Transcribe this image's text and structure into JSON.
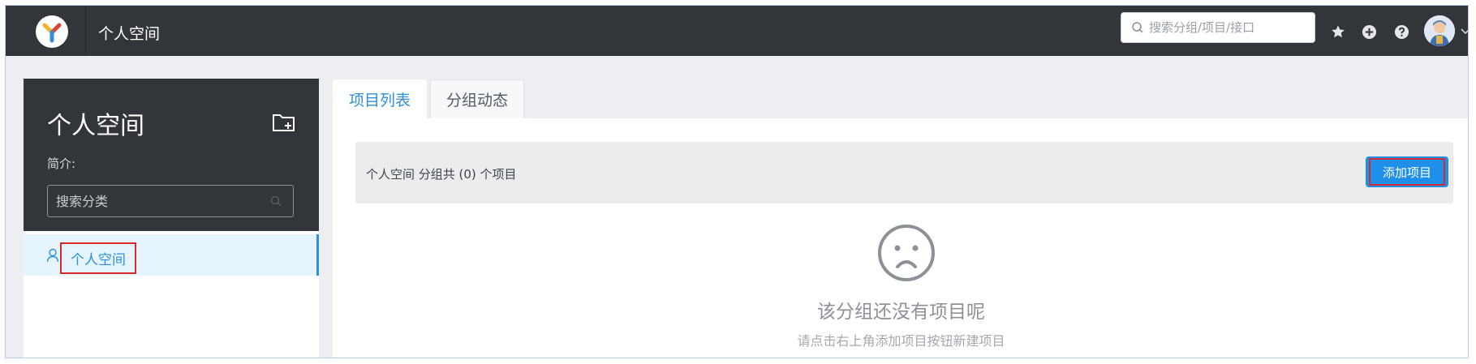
{
  "header": {
    "title": "个人空间",
    "search": {
      "placeholder": "搜索分组/项目/接口",
      "value": ""
    },
    "icons": [
      "logo-icon",
      "search-icon",
      "star-icon",
      "add-circle-icon",
      "help-icon",
      "avatar",
      "chevron-down-icon"
    ]
  },
  "sidebar": {
    "title": "个人空间",
    "description_label": "简介:",
    "search": {
      "placeholder": "搜索分类",
      "value": ""
    },
    "items": [
      {
        "label": "个人空间",
        "icon": "user-icon",
        "selected": true
      }
    ]
  },
  "main": {
    "tabs": [
      {
        "label": "项目列表",
        "active": true
      },
      {
        "label": "分组动态",
        "active": false
      }
    ],
    "summary": "个人空间 分组共 (0) 个项目",
    "add_button_label": "添加项目",
    "empty_state": {
      "title": "该分组还没有项目呢",
      "subtitle": "请点击右上角添加项目按钮新建项目"
    }
  },
  "colors": {
    "header_bg": "#32363a",
    "accent": "#2f8fdc",
    "primary_button": "#1e90ea",
    "highlight_border": "#d9292c"
  }
}
